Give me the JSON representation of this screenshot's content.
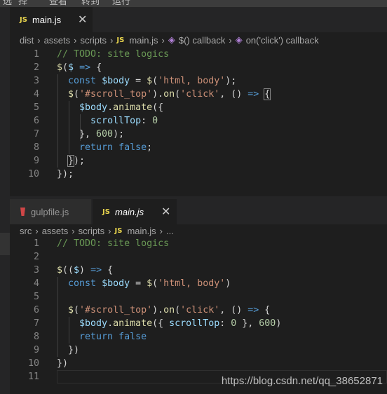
{
  "menubar": [
    "选",
    "择",
    "查看",
    "转到",
    "运行"
  ],
  "pane1": {
    "tab": {
      "badge": "JS",
      "name": "main.js",
      "close": "✕"
    },
    "breadcrumb": [
      "dist",
      "assets",
      "scripts",
      "main.js",
      "$() callback",
      "on('click') callback"
    ],
    "lines": [
      "1",
      "2",
      "3",
      "4",
      "5",
      "6",
      "7",
      "8",
      "9",
      "10"
    ]
  },
  "pane2": {
    "tabs": [
      {
        "name": "gulpfile.js"
      },
      {
        "badge": "JS",
        "name": "main.js",
        "close": "✕"
      }
    ],
    "breadcrumb": [
      "src",
      "assets",
      "scripts",
      "main.js",
      "..."
    ],
    "lines": [
      "1",
      "2",
      "3",
      "4",
      "5",
      "6",
      "7",
      "8",
      "9",
      "10",
      "11"
    ]
  },
  "code1": [
    "// TODO: site logics",
    "$($ => {",
    "  const $body = $('html, body');",
    "  $('#scroll_top').on('click', () => {",
    "    $body.animate({",
    "      scrollTop: 0",
    "    }, 600);",
    "    return false;",
    "  });",
    "});"
  ],
  "code2": [
    "// TODO: site logics",
    "",
    "$(($) => {",
    "  const $body = $('html, body')",
    "",
    "  $('#scroll_top').on('click', () => {",
    "    $body.animate({ scrollTop: 0 }, 600)",
    "    return false",
    "  })",
    "})",
    ""
  ],
  "watermark": "https://blog.csdn.net/qq_38652871",
  "colors": {
    "comment": "#6a9955",
    "keyword": "#569cd6",
    "variable": "#9cdcfe",
    "string": "#ce9178",
    "function": "#dcdcaa",
    "number": "#b5cea8"
  }
}
